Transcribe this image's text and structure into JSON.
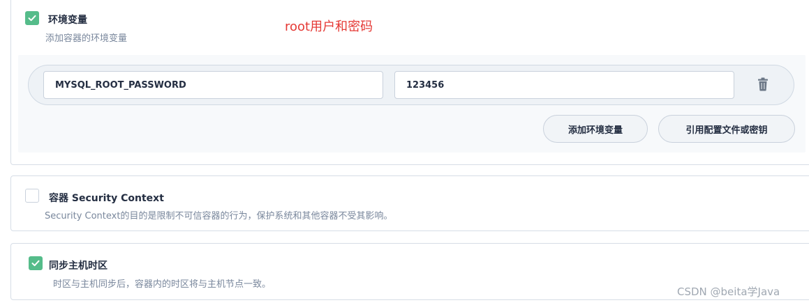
{
  "env_section": {
    "checked": true,
    "title": "环境变量",
    "description": "添加容器的环境变量",
    "annotation": "root用户和密码",
    "variables": [
      {
        "key": "MYSQL_ROOT_PASSWORD",
        "value": "123456"
      }
    ],
    "add_button": "添加环境变量",
    "ref_button": "引用配置文件或密钥"
  },
  "security_section": {
    "checked": false,
    "title": "容器 Security Context",
    "description": "Security Context的目的是限制不可信容器的行为，保护系统和其他容器不受其影响。"
  },
  "timezone_section": {
    "checked": true,
    "title": "同步主机时区",
    "description": "时区与主机同步后，容器内的时区将与主机节点一致。"
  },
  "watermark": "CSDN @beita学Java",
  "colors": {
    "accent_green": "#55bc8a",
    "annotation_red": "#e53935",
    "text_dark": "#242e42",
    "text_muted": "#79879c"
  }
}
